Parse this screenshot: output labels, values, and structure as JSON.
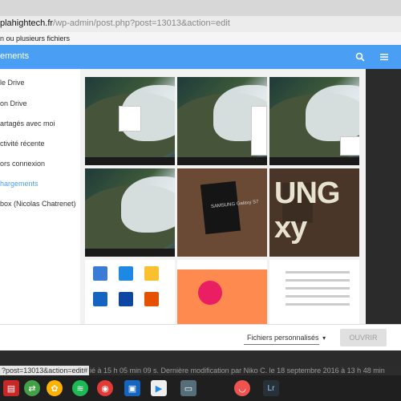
{
  "browser": {
    "address_host": "plahightech.fr",
    "address_path": "/wp-admin/post.php?post=13013&action=edit"
  },
  "dialog": {
    "title": "n ou plusieurs fichiers"
  },
  "appbar": {
    "title": "ements",
    "search_icon": "search-icon",
    "menu_icon": "menu-icon"
  },
  "sidebar": {
    "items": [
      {
        "label": "le Drive"
      },
      {
        "label": "on Drive"
      },
      {
        "label": "artagés avec moi"
      },
      {
        "label": "ctivité récente"
      },
      {
        "label": "ors connexion"
      },
      {
        "label": "hargements",
        "active": true
      },
      {
        "label": "box (Nicolas Chatrenet)"
      }
    ]
  },
  "thumbnails": [
    {
      "type": "landscape"
    },
    {
      "type": "landscape"
    },
    {
      "type": "landscape"
    },
    {
      "type": "landscape"
    },
    {
      "type": "phone",
      "caption": "SAMSUNG Galaxy S7"
    },
    {
      "type": "dark",
      "caption": "UNG xy"
    },
    {
      "type": "store"
    },
    {
      "type": "promo"
    },
    {
      "type": "list"
    }
  ],
  "footer": {
    "filter_label": "Fichiers personnalisés",
    "open_label": "OUVRIR"
  },
  "status": {
    "url": "?post=13013&action=edit#",
    "meta": "ié à 15 h 05 min 09 s. Dernière modification par Niko C. le 18 septembre 2016 à 13 h 48 min"
  },
  "dock": {
    "icons": [
      "pdf-icon",
      "arrows-icon",
      "pinwheel-icon",
      "spotify-icon",
      "chrome-icon",
      "camera-icon",
      "play-store-icon",
      "desktop-icon",
      "pocket-icon",
      "lightroom-icon"
    ]
  },
  "colors": {
    "accent": "#4a9ff5"
  }
}
